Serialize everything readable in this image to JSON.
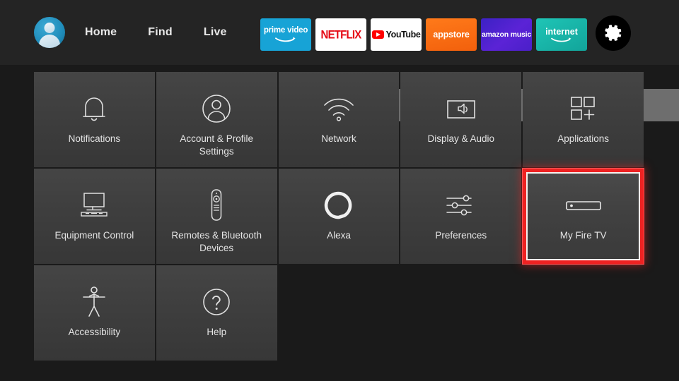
{
  "topbar": {
    "avatar_name": "profile-avatar",
    "nav": [
      {
        "label": "Home"
      },
      {
        "label": "Find"
      },
      {
        "label": "Live"
      }
    ],
    "apps": [
      {
        "id": "prime-video",
        "line1": "prime video",
        "icon": "amazon-swoosh"
      },
      {
        "id": "netflix",
        "label": "NETFLIX",
        "icon": "netflix-wordmark"
      },
      {
        "id": "youtube",
        "label": "YouTube",
        "icon": "youtube-play-icon"
      },
      {
        "id": "appstore",
        "label": "appstore",
        "icon": "appstore-wordmark"
      },
      {
        "id": "amazon-music",
        "line1": "amazon music",
        "icon": "amazon-swoosh"
      },
      {
        "id": "internet",
        "label": "internet",
        "icon": "amazon-swoosh"
      },
      {
        "id": "apps-grid",
        "label": "",
        "icon": "apps-grid-plus-icon"
      },
      {
        "id": "settings-gear",
        "label": "",
        "icon": "gear-icon"
      }
    ]
  },
  "settings_grid": {
    "tiles": [
      {
        "label": "Notifications",
        "icon": "bell-icon",
        "selected": false
      },
      {
        "label": "Account & Profile Settings",
        "icon": "person-circle-icon",
        "selected": false
      },
      {
        "label": "Network",
        "icon": "wifi-icon",
        "selected": false
      },
      {
        "label": "Display & Audio",
        "icon": "display-audio-icon",
        "selected": false
      },
      {
        "label": "Applications",
        "icon": "applications-grid-icon",
        "selected": false
      },
      {
        "label": "Equipment Control",
        "icon": "tv-soundbar-icon",
        "selected": false
      },
      {
        "label": "Remotes & Bluetooth Devices",
        "icon": "remote-control-icon",
        "selected": false
      },
      {
        "label": "Alexa",
        "icon": "alexa-ring-icon",
        "selected": false
      },
      {
        "label": "Preferences",
        "icon": "sliders-icon",
        "selected": false
      },
      {
        "label": "My Fire TV",
        "icon": "fire-tv-stick-icon",
        "selected": true
      },
      {
        "label": "Accessibility",
        "icon": "accessibility-person-icon",
        "selected": false
      },
      {
        "label": "Help",
        "icon": "question-circle-icon",
        "selected": false
      }
    ]
  },
  "colors": {
    "background": "#1a1a1a",
    "topbar": "#242424",
    "tile": "#3e3e3e",
    "selection_red": "#ee2222",
    "text": "#e4e4e4"
  }
}
